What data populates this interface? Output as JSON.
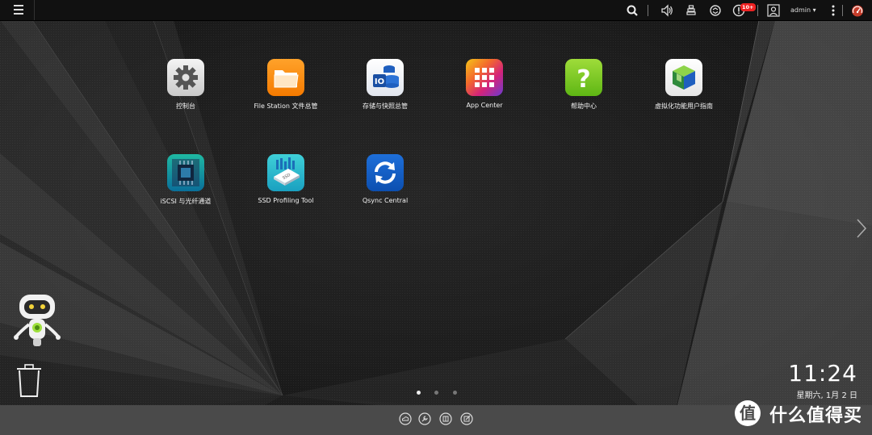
{
  "topbar": {
    "menu_icon": "hamburger-icon",
    "search_icon": "search-icon",
    "volume_icon": "volume-icon",
    "tasks_icon": "stack-icon",
    "sync_icon": "sync-icon",
    "notifications_icon": "info-icon",
    "notification_badge": "10+",
    "user_icon": "user-icon",
    "user_name": "admin ▾",
    "more_icon": "more-vertical-icon",
    "dashboard_icon": "gauge-icon"
  },
  "apps": [
    {
      "label": "控制台",
      "icon": "gear-icon"
    },
    {
      "label": "File Station 文件总管",
      "icon": "folder-icon"
    },
    {
      "label": "存储与快照总管",
      "icon": "storage-icon"
    },
    {
      "label": "App Center",
      "icon": "grid-icon"
    },
    {
      "label": "帮助中心",
      "icon": "question-icon"
    },
    {
      "label": "虚拟化功能用户指南",
      "icon": "cube-icon"
    },
    {
      "label": "iSCSI 与光纤通道",
      "icon": "chip-icon"
    },
    {
      "label": "SSD Profiling Tool",
      "icon": "ssd-icon"
    },
    {
      "label": "Qsync Central",
      "icon": "qsync-icon"
    }
  ],
  "pager": {
    "active_index": 0,
    "count": 3
  },
  "clock": {
    "time": "11:24",
    "date": "星期六, 1月 2 日"
  },
  "watermark": {
    "text": "什么值得买"
  },
  "colors": {
    "topbar": "#111111",
    "bottombar": "#4a4a4a",
    "badge": "#e22222"
  }
}
